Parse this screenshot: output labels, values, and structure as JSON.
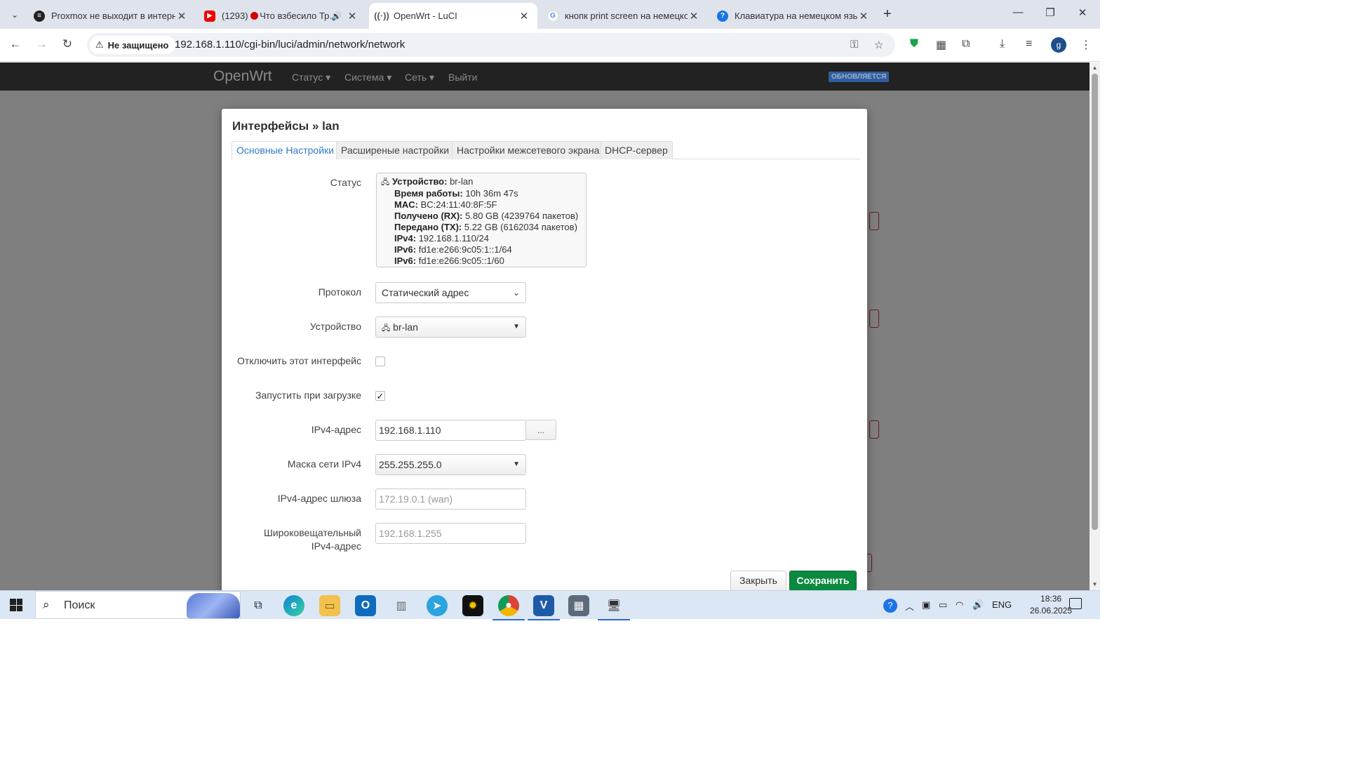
{
  "browser": {
    "tabs": [
      {
        "title": "Proxmox не выходит в интерн…",
        "favicon": "proxmox-icon",
        "active": false
      },
      {
        "title": "(1293) Что взбесило Тр…",
        "favicon": "youtube-icon",
        "active": false,
        "audio": true
      },
      {
        "title": "OpenWrt - LuCI",
        "favicon": "openwrt-icon",
        "active": true
      },
      {
        "title": "кнопк print screen на немецко…",
        "favicon": "google-icon",
        "active": false
      },
      {
        "title": "Клавиатура на немецком язы…",
        "favicon": "help-icon",
        "active": false
      }
    ],
    "security_label": "Не защищено",
    "url": "192.168.1.110/cgi-bin/luci/admin/network/network",
    "profile_initial": "g"
  },
  "luci": {
    "brand": "OpenWrt",
    "menu": [
      "Статус",
      "Система",
      "Сеть",
      "Выйти"
    ],
    "refresh_badge": "ОБНОВЛЯЕТСЯ"
  },
  "modal": {
    "title": "Интерфейсы » lan",
    "tabs": [
      "Основные Настройки",
      "Расширеные настройки",
      "Настройки межсетевого экрана",
      "DHCP-сервер"
    ],
    "status": {
      "label": "Статус",
      "lines": [
        {
          "key": "Устройство:",
          "value": "br-lan"
        },
        {
          "key": "Время работы:",
          "value": "10h 36m 47s"
        },
        {
          "key": "MAC:",
          "value": "BC:24:11:40:8F:5F"
        },
        {
          "key": "Получено (RX):",
          "value": "5.80 GB (4239764 пакетов)"
        },
        {
          "key": "Передано (TX):",
          "value": "5.22 GB (6162034 пакетов)"
        },
        {
          "key": "IPv4:",
          "value": "192.168.1.110/24"
        },
        {
          "key": "IPv6:",
          "value": "fd1e:e266:9c05:1::1/64"
        },
        {
          "key": "IPv6:",
          "value": "fd1e:e266:9c05::1/60"
        }
      ]
    },
    "fields": {
      "protocol": {
        "label": "Протокол",
        "value": "Статический адрес"
      },
      "device": {
        "label": "Устройство",
        "value": "br-lan"
      },
      "disable": {
        "label": "Отключить этот интерфейс",
        "checked": false
      },
      "autostart": {
        "label": "Запустить при загрузке",
        "checked": true
      },
      "ipv4_address": {
        "label": "IPv4-адрес",
        "value": "192.168.1.110",
        "more_label": "..."
      },
      "netmask": {
        "label": "Маска сети IPv4",
        "value": "255.255.255.0"
      },
      "gateway": {
        "label": "IPv4-адрес шлюза",
        "placeholder": "172.19.0.1 (wan)"
      },
      "broadcast": {
        "label": "Широковещательный IPv4-адрес",
        "placeholder": "192.168.1.255"
      }
    },
    "buttons": {
      "close": "Закрыть",
      "save": "Сохранить"
    }
  },
  "taskbar": {
    "search_placeholder": "Поиск",
    "language": "ENG",
    "time": "18:36",
    "date": "26.06.2025"
  }
}
